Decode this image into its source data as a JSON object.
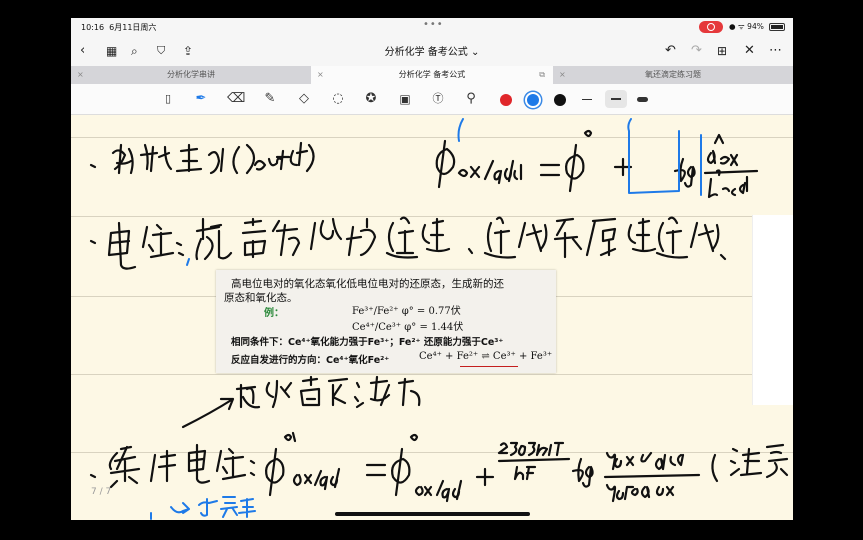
{
  "status": {
    "time": "10:16",
    "date": "6月11日周六",
    "battery": "94%"
  },
  "nav": {
    "title": "分析化学 备考公式"
  },
  "tabs": [
    {
      "label": "分析化学串讲"
    },
    {
      "label": "分析化学 备考公式"
    },
    {
      "label": "氧还滴定练习题"
    }
  ],
  "colors": {
    "red": "#e0262a",
    "blue": "#1e7ae8",
    "black": "#111111",
    "accent": "#3b8ae6"
  },
  "toolbar_icons": [
    "page-layout-icon",
    "pen-icon",
    "eraser-icon",
    "highlighter-icon",
    "shapes-icon",
    "lasso-icon",
    "sticker-icon",
    "image-icon",
    "text-icon",
    "laser-pointer-icon"
  ],
  "page": {
    "number": "7 / 7"
  },
  "snippet": {
    "line1": "高电位电对的氧化态氧化低电位电对的还原态，生成新的还",
    "line2": "原态和氧化态。",
    "example_label": "例：",
    "reaction1": "Fe³⁺/Fe²⁺   φ° = 0.77伏",
    "reaction2": "Ce⁴⁺/Ce³⁺   φ° = 1.44伏",
    "line5": "相同条件下：Ce⁴⁺氧化能力强于Fe³⁺；Fe²⁺ 还原能力强于Ce³⁺",
    "line6": "反应自发进行的方向：Ce⁴⁺氧化Fe²⁺",
    "reaction3": "Ce⁴⁺ + Fe²⁺ ⇌ Ce³⁺ + Fe³⁺"
  },
  "handwriting": {
    "line1": "、能斯特方程(Nernst)  φ_Ox/Red = φ° + (0.059/n) lg (a_Ox^a / b_Red^b)",
    "line2": "、电位：越高氧化性越强，越低还原性越强",
    "note": "反映离子强度，副反应",
    "line3": "、条件电位：φ°'_Ox/Red = φ°_Ox/Red + (2.303RT/nF) lg (γ_Ox α_Red / γ_Red α_Ox)   (浓度",
    "blue_note": "可查表"
  }
}
